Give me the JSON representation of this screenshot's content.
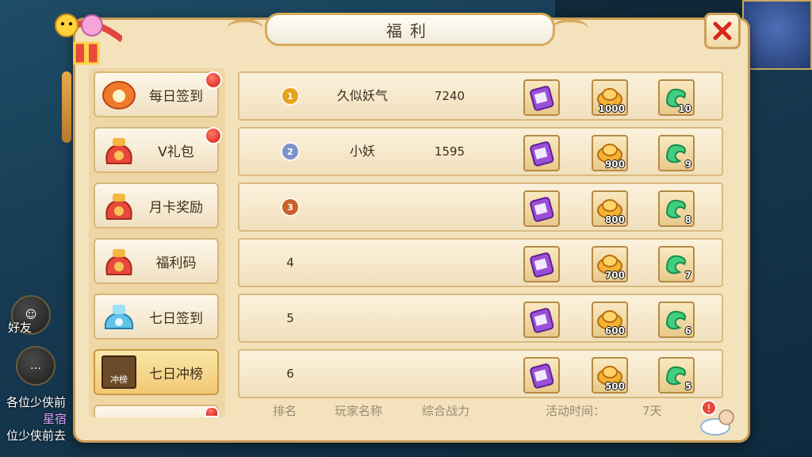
{
  "title": "福利",
  "sidebar": {
    "items": [
      {
        "label": "每日签到",
        "icon": "lantern-icon",
        "badge": true,
        "active": false
      },
      {
        "label": "V礼包",
        "icon": "gift-bag-icon",
        "badge": true,
        "active": false
      },
      {
        "label": "月卡奖励",
        "icon": "gift-bag-icon",
        "badge": false,
        "active": false
      },
      {
        "label": "福利码",
        "icon": "gift-bag-icon",
        "badge": false,
        "active": false
      },
      {
        "label": "七日签到",
        "icon": "blue-gift-icon",
        "badge": false,
        "active": false
      },
      {
        "label": "七日冲榜",
        "icon": "ranking-icon",
        "badge": false,
        "active": true,
        "icon_text": "冲榜"
      },
      {
        "label": "",
        "icon": "gift-bag-icon",
        "badge": true,
        "active": false
      }
    ]
  },
  "ranking": {
    "rows": [
      {
        "rank": "1",
        "name": "久似妖气",
        "power": "7240",
        "rewards": [
          "",
          "1000",
          "10"
        ]
      },
      {
        "rank": "2",
        "name": "小妖",
        "power": "1595",
        "rewards": [
          "",
          "900",
          "9"
        ]
      },
      {
        "rank": "3",
        "name": "",
        "power": "",
        "rewards": [
          "",
          "800",
          "8"
        ]
      },
      {
        "rank": "4",
        "name": "",
        "power": "",
        "rewards": [
          "",
          "700",
          "7"
        ]
      },
      {
        "rank": "5",
        "name": "",
        "power": "",
        "rewards": [
          "",
          "600",
          "6"
        ]
      },
      {
        "rank": "6",
        "name": "",
        "power": "",
        "rewards": [
          "",
          "500",
          "5"
        ]
      }
    ],
    "reward_icons": [
      "purple-scroll-icon",
      "gold-ingot-icon",
      "jade-icon"
    ]
  },
  "footer": {
    "rank_label": "排名",
    "name_label": "玩家名称",
    "power_label": "综合战力",
    "time_label": "活动时间：",
    "time_value": "7天"
  },
  "background": {
    "friend_label": "好友",
    "chat_lines": [
      "各位少侠前",
      "星宿",
      "位少侠前去"
    ]
  },
  "colors": {
    "panel": "#f4e2bd",
    "border": "#c79a52",
    "badge": "#d41c12",
    "medal_gold": "#e8a21c",
    "medal_silver": "#7e93c8",
    "medal_bronze": "#c8612a"
  }
}
